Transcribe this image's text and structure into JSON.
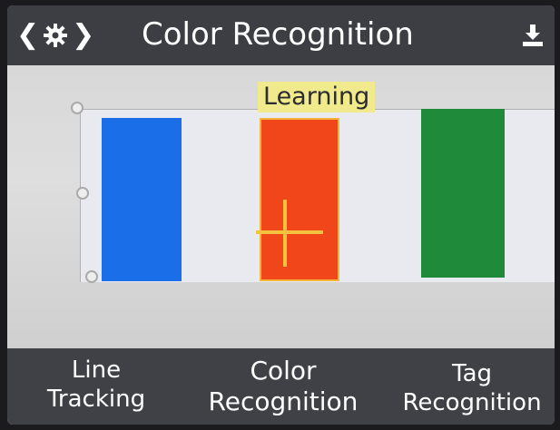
{
  "header": {
    "title": "Color Recognition",
    "back_icon": "chevron-left-icon",
    "settings_icon": "gear-icon",
    "forward_icon": "chevron-right-icon",
    "download_icon": "download-icon"
  },
  "camera": {
    "status_label": "Learning",
    "targets": [
      {
        "name": "blue-bar",
        "color": "#1a6ee8"
      },
      {
        "name": "red-bar",
        "color": "#f0461a"
      },
      {
        "name": "green-bar",
        "color": "#1f8a3a"
      }
    ],
    "crosshair_color": "#f3c23e"
  },
  "modes": [
    {
      "line1": "Line",
      "line2": "Tracking"
    },
    {
      "line1": "Color",
      "line2": "Recognition"
    },
    {
      "line1": "Tag",
      "line2": "Recognition"
    }
  ],
  "colors": {
    "bar_bg": "#3d3e44",
    "accent_yellow": "#f3c23e",
    "label_bg": "#f0ea8c"
  }
}
